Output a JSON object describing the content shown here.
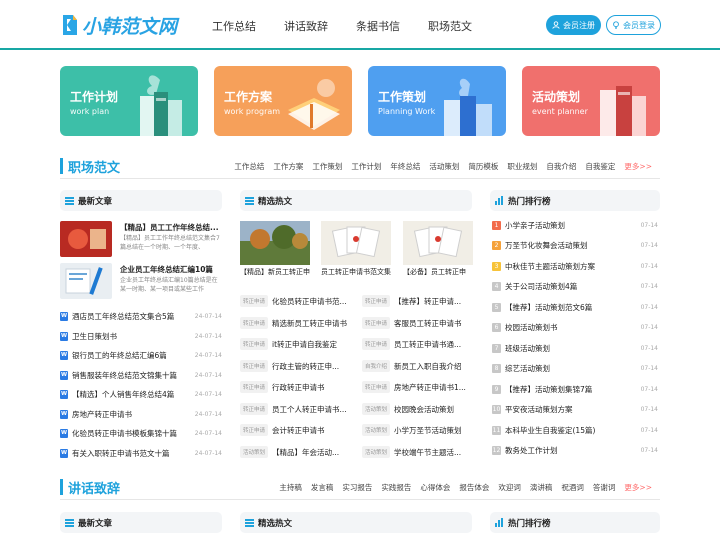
{
  "header": {
    "logo_text": "小韩范文网",
    "nav": [
      "工作总结",
      "讲话致辞",
      "条据书信",
      "职场范文"
    ],
    "register_label": "会员注册",
    "login_label": "会员登录"
  },
  "cards": [
    {
      "title": "工作计划",
      "subtitle": "work plan",
      "color": "#3dbfa8"
    },
    {
      "title": "工作方案",
      "subtitle": "work program",
      "color": "#f6a05a"
    },
    {
      "title": "工作策划",
      "subtitle": "Planning Work",
      "color": "#4f9ff0"
    },
    {
      "title": "活动策划",
      "subtitle": "event planner",
      "color": "#f0706d"
    }
  ],
  "section1": {
    "title": "职场范文",
    "links": [
      "工作总结",
      "工作方案",
      "工作策划",
      "工作计划",
      "年终总结",
      "活动策划",
      "简历模板",
      "职业规划",
      "自我介绍",
      "自我鉴定"
    ],
    "more": "更多>>"
  },
  "col1": {
    "head": "最新文章",
    "featured": [
      {
        "title": "【精品】员工工作年终总结...",
        "desc": "【精品】员工工作年终总结范文集合7篇总结在一个时期、一个年度、"
      },
      {
        "title": "企业员工年终总结汇编10篇",
        "desc": "企业员工年终总结汇编10篇总结是在某一时期、某一项目或某些工作"
      }
    ],
    "articles": [
      {
        "title": "酒店员工年终总结范文集合5篇",
        "date": "24-07-14"
      },
      {
        "title": "卫生日策划书",
        "date": "24-07-14"
      },
      {
        "title": "银行员工的年终总结汇编6篇",
        "date": "24-07-14"
      },
      {
        "title": "销售服装年终总结范文锦集十篇",
        "date": "24-07-14"
      },
      {
        "title": "【精选】个人销售年终总结4篇",
        "date": "24-07-14"
      },
      {
        "title": "房地产转正申请书",
        "date": "24-07-14"
      },
      {
        "title": "化验员转正申请书模板集锦十篇",
        "date": "24-07-14"
      },
      {
        "title": "有关入职转正申请书范文十篇",
        "date": "24-07-14"
      }
    ]
  },
  "col2": {
    "head": "精选热文",
    "thumbs": [
      "【精品】新员工转正申",
      "员工转正申请书范文集",
      "【必备】员工转正申"
    ],
    "left": [
      {
        "tag": "转正申请",
        "title": "化验员转正申请书范..."
      },
      {
        "tag": "转正申请",
        "title": "精选新员工转正申请书"
      },
      {
        "tag": "转正申请",
        "title": "it转正申请自我鉴定"
      },
      {
        "tag": "转正申请",
        "title": "行政主管的转正申..."
      },
      {
        "tag": "转正申请",
        "title": "行政转正申请书"
      },
      {
        "tag": "转正申请",
        "title": "员工个人转正申请书..."
      },
      {
        "tag": "转正申请",
        "title": "会计转正申请书"
      },
      {
        "tag": "活动策划",
        "title": "【精品】年会活动..."
      }
    ],
    "right": [
      {
        "tag": "转正申请",
        "title": "【推荐】转正申请..."
      },
      {
        "tag": "转正申请",
        "title": "客服员工转正申请书"
      },
      {
        "tag": "转正申请",
        "title": "员工转正申请书通..."
      },
      {
        "tag": "自我介绍",
        "title": "新员工入职自我介绍"
      },
      {
        "tag": "转正申请",
        "title": "房地产转正申请书1..."
      },
      {
        "tag": "活动策划",
        "title": "校园晚会活动策划"
      },
      {
        "tag": "活动策划",
        "title": "小学万圣节活动策划"
      },
      {
        "tag": "活动策划",
        "title": "学校端午节主题活..."
      }
    ]
  },
  "col3": {
    "head": "热门排行榜",
    "items": [
      {
        "rank": "1",
        "title": "小学亲子活动策划",
        "date": "07-14",
        "color": "#f26b4b"
      },
      {
        "rank": "2",
        "title": "万圣节化妆舞会活动策划",
        "date": "07-14",
        "color": "#f5a23b"
      },
      {
        "rank": "3",
        "title": "中秋佳节主题活动策划方案",
        "date": "07-14",
        "color": "#f7c33a"
      },
      {
        "rank": "4",
        "title": "关于公司活动策划4篇",
        "date": "07-14",
        "color": "#c7c7c7"
      },
      {
        "rank": "5",
        "title": "【推荐】活动策划范文6篇",
        "date": "07-14",
        "color": "#c7c7c7"
      },
      {
        "rank": "6",
        "title": "校园活动策划书",
        "date": "07-14",
        "color": "#c7c7c7"
      },
      {
        "rank": "7",
        "title": "班级活动策划",
        "date": "07-14",
        "color": "#c7c7c7"
      },
      {
        "rank": "8",
        "title": "综艺活动策划",
        "date": "07-14",
        "color": "#c7c7c7"
      },
      {
        "rank": "9",
        "title": "【推荐】活动策划集锦7篇",
        "date": "07-14",
        "color": "#c7c7c7"
      },
      {
        "rank": "10",
        "title": "平安夜活动策划方案",
        "date": "07-14",
        "color": "#c7c7c7"
      },
      {
        "rank": "11",
        "title": "本科毕业生自我鉴定(15篇)",
        "date": "07-14",
        "color": "#c7c7c7"
      },
      {
        "rank": "12",
        "title": "教务处工作计划",
        "date": "07-14",
        "color": "#c7c7c7"
      }
    ]
  },
  "section2": {
    "title": "讲话致辞",
    "links": [
      "主持稿",
      "发言稿",
      "实习报告",
      "实践报告",
      "心得体会",
      "报告体会",
      "欢迎词",
      "演讲稿",
      "祝酒词",
      "答谢词"
    ],
    "more": "更多>>"
  },
  "bottom_heads": [
    "最新文章",
    "精选热文",
    "热门排行榜"
  ]
}
